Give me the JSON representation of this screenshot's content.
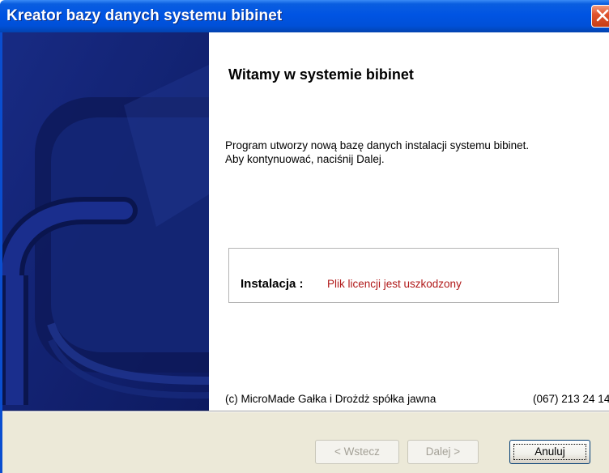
{
  "window": {
    "title": "Kreator bazy danych systemu bibinet",
    "close_icon": "close-icon",
    "colors": {
      "titlebar": "#0054e3",
      "close_button": "#e0542e",
      "art_panel": "#13237a",
      "status_error": "#b01818",
      "button_bar": "#ece9d8"
    }
  },
  "main": {
    "heading": "Witamy w systemie bibinet",
    "intro_line1": "Program utworzy nową bazę danych instalacji systemu bibinet.",
    "intro_line2": "Aby kontynuować, naciśnij Dalej.",
    "install_label": "Instalacja :",
    "install_status": "Plik licencji jest uszkodzony",
    "copyright": "(c) MicroMade Gałka i Drożdż spółka jawna",
    "phone": "(067) 213 24 14"
  },
  "buttons": {
    "back_label": "< Wstecz",
    "next_label": "Dalej >",
    "cancel_label": "Anuluj"
  }
}
